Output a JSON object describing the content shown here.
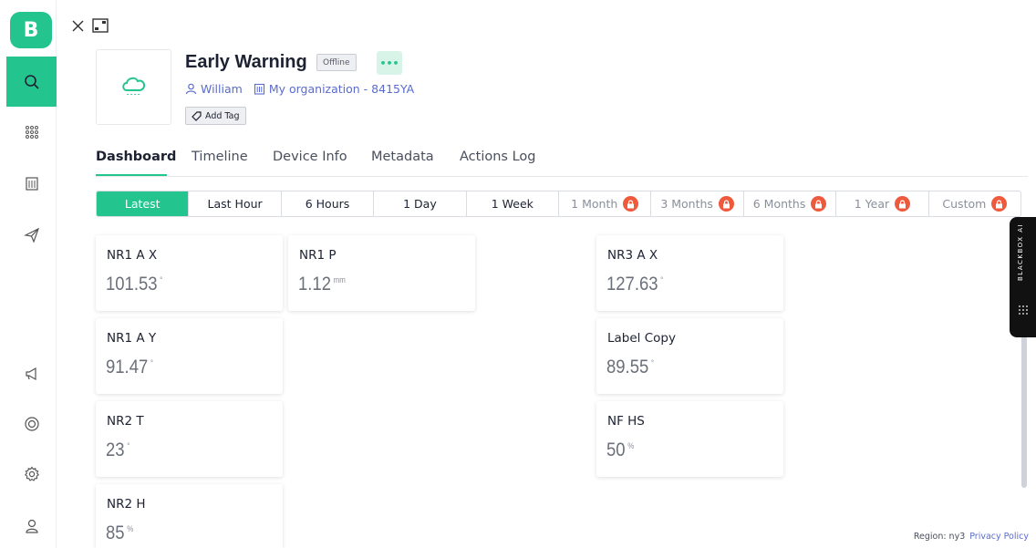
{
  "brand": {
    "logo_letter": "B",
    "accent": "#23c48e"
  },
  "sidebar": {
    "items": [
      {
        "name": "search-icon"
      },
      {
        "name": "grid-icon"
      },
      {
        "name": "building-icon"
      },
      {
        "name": "send-icon"
      },
      {
        "name": "megaphone-icon"
      },
      {
        "name": "lifebuoy-icon"
      },
      {
        "name": "gear-icon"
      },
      {
        "name": "user-icon"
      }
    ]
  },
  "device": {
    "title": "Early Warning",
    "status": "Offline",
    "more_label": "•••",
    "owner": "William",
    "organization": "My organization - 8415YA",
    "add_tag": "Add Tag"
  },
  "tabs": [
    "Dashboard",
    "Timeline",
    "Device Info",
    "Metadata",
    "Actions Log"
  ],
  "time_ranges": [
    {
      "label": "Latest",
      "active": true,
      "locked": false
    },
    {
      "label": "Last Hour",
      "active": false,
      "locked": false
    },
    {
      "label": "6 Hours",
      "active": false,
      "locked": false
    },
    {
      "label": "1 Day",
      "active": false,
      "locked": false
    },
    {
      "label": "1 Week",
      "active": false,
      "locked": false
    },
    {
      "label": "1 Month",
      "active": false,
      "locked": true
    },
    {
      "label": "3 Months",
      "active": false,
      "locked": true
    },
    {
      "label": "6 Months",
      "active": false,
      "locked": true
    },
    {
      "label": "1 Year",
      "active": false,
      "locked": true
    },
    {
      "label": "Custom",
      "active": false,
      "locked": true
    }
  ],
  "widgets": [
    {
      "label": "NR1 A X",
      "value": "101.53",
      "unit": "°"
    },
    {
      "label": "NR1 P",
      "value": "1.12",
      "unit": "mm"
    },
    {
      "label": "NR3 A X",
      "value": "127.63",
      "unit": "°"
    },
    {
      "label": "NR1 A Y",
      "value": "91.47",
      "unit": "°"
    },
    {
      "label": "Label Copy",
      "value": "89.55",
      "unit": "°"
    },
    {
      "label": "NR2 T",
      "value": "23",
      "unit": "°"
    },
    {
      "label": "NF HS",
      "value": "50",
      "unit": "%"
    },
    {
      "label": "NR2 H",
      "value": "85",
      "unit": "%"
    }
  ],
  "ai_panel": {
    "label": "BLACKBOX AI"
  },
  "footer": {
    "region": "Region: ny3",
    "privacy": "Privacy Policy"
  }
}
